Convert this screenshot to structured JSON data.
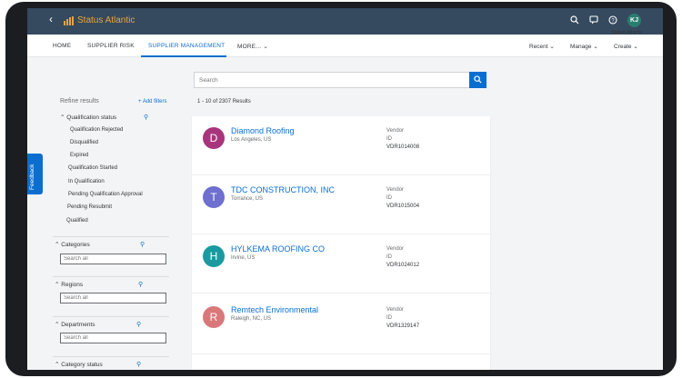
{
  "shell": {
    "back_icon": "chevron-left-icon",
    "app_name": "Status Atlantic",
    "tenant": "Status Atlantic",
    "user_initials": "KJ",
    "icons": [
      "search-icon",
      "notification-icon",
      "help-icon"
    ]
  },
  "nav": {
    "tabs": [
      {
        "label": "HOME"
      },
      {
        "label": "SUPPLIER RISK"
      },
      {
        "label": "SUPPLIER MANAGEMENT"
      },
      {
        "label": "MORE..."
      }
    ],
    "active_tab": "SUPPLIER MANAGEMENT",
    "menus": [
      {
        "label": "Recent"
      },
      {
        "label": "Manage"
      },
      {
        "label": "Create"
      }
    ]
  },
  "feedback": {
    "label": "Feedback"
  },
  "sidebar": {
    "refine_label": "Refine results",
    "add_filters": "+ Add filters",
    "qualification": {
      "label": "Qualification status",
      "items": [
        "Qualification Rejected",
        "Disqualified",
        "Expired",
        "Qualification Started",
        "In Qualification",
        "Pending Qualification Approval",
        "Pending Resubmit",
        "Qualified"
      ]
    },
    "facets": [
      {
        "label": "Categories",
        "placeholder": "Search all"
      },
      {
        "label": "Regions",
        "placeholder": "Search all"
      },
      {
        "label": "Departments",
        "placeholder": "Search all"
      },
      {
        "label": "Category status"
      }
    ]
  },
  "search": {
    "placeholder": "Search"
  },
  "result_count": "1 - 10 of 2307 Results",
  "results": [
    {
      "initial": "D",
      "name": "Diamond Roofing",
      "location": "Los Angeles, US",
      "type": "Vendor",
      "id_label": "ID",
      "id": "VDR1014008",
      "color": "#a6357c"
    },
    {
      "initial": "T",
      "name": "TDC CONSTRUCTION, INC",
      "location": "Torrance, US",
      "type": "Vendor",
      "id_label": "ID",
      "id": "VDR1015004",
      "color": "#6f6fd0"
    },
    {
      "initial": "H",
      "name": "HYLKEMA ROOFING CO",
      "location": "Irvine, US",
      "type": "Vendor",
      "id_label": "ID",
      "id": "VDR1024012",
      "color": "#1a9aa0"
    },
    {
      "initial": "R",
      "name": "Remtech Environmental",
      "location": "Raleigh, NC, US",
      "type": "Vendor",
      "id_label": "ID",
      "id": "VDR1329147",
      "color": "#d9787a"
    }
  ]
}
